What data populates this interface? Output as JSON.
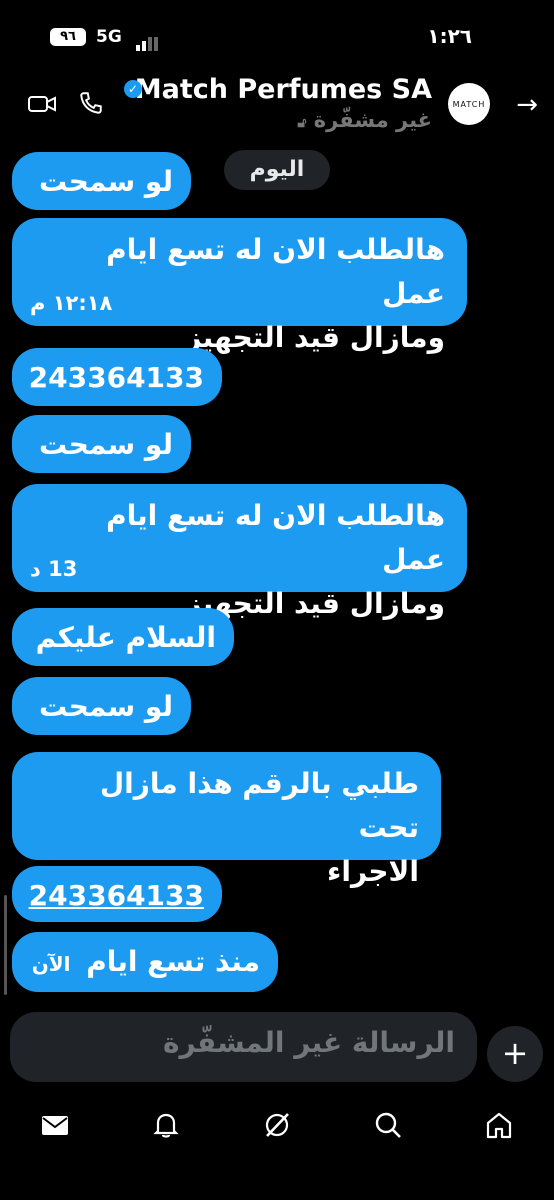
{
  "status_bar": {
    "battery": "٩٦",
    "network": "5G",
    "time": "١:٢٦"
  },
  "header": {
    "contact_name": "Match Perfumes SA",
    "avatar_text": "MATCH",
    "encryption_status": "غير مشفّرة",
    "icons": {
      "back": "arrow-right-icon",
      "video": "video-call-icon",
      "phone": "phone-call-icon",
      "verified": "verified-badge-icon",
      "lock": "lock-icon"
    }
  },
  "chat": {
    "date_separator": "اليوم",
    "messages": [
      {
        "text": "لو سمحت"
      },
      {
        "line1": "هالطلب الان له تسع ايام عمل",
        "line2": "ومازال قيد التجهيز",
        "time": "١٢:١٨ م"
      },
      {
        "text": "243364133"
      },
      {
        "text": "لو سمحت"
      },
      {
        "line1": "هالطلب الان له تسع ايام عمل",
        "line2": "ومازال قيد التجهيز",
        "time": "13 د"
      },
      {
        "text": "السلام عليكم"
      },
      {
        "text": "لو سمحت"
      },
      {
        "line1": "طلبي بالرقم هذا مازال تحت",
        "line2": "الاجراء"
      },
      {
        "text": "243364133"
      },
      {
        "text": "منذ تسع ايام",
        "time": "الآن"
      }
    ]
  },
  "composer": {
    "placeholder": "الرسالة غير المشفّرة",
    "add_label": "+"
  },
  "tabbar": {
    "items": [
      "messages-icon",
      "notifications-icon",
      "grok-icon",
      "search-icon",
      "home-icon"
    ]
  }
}
